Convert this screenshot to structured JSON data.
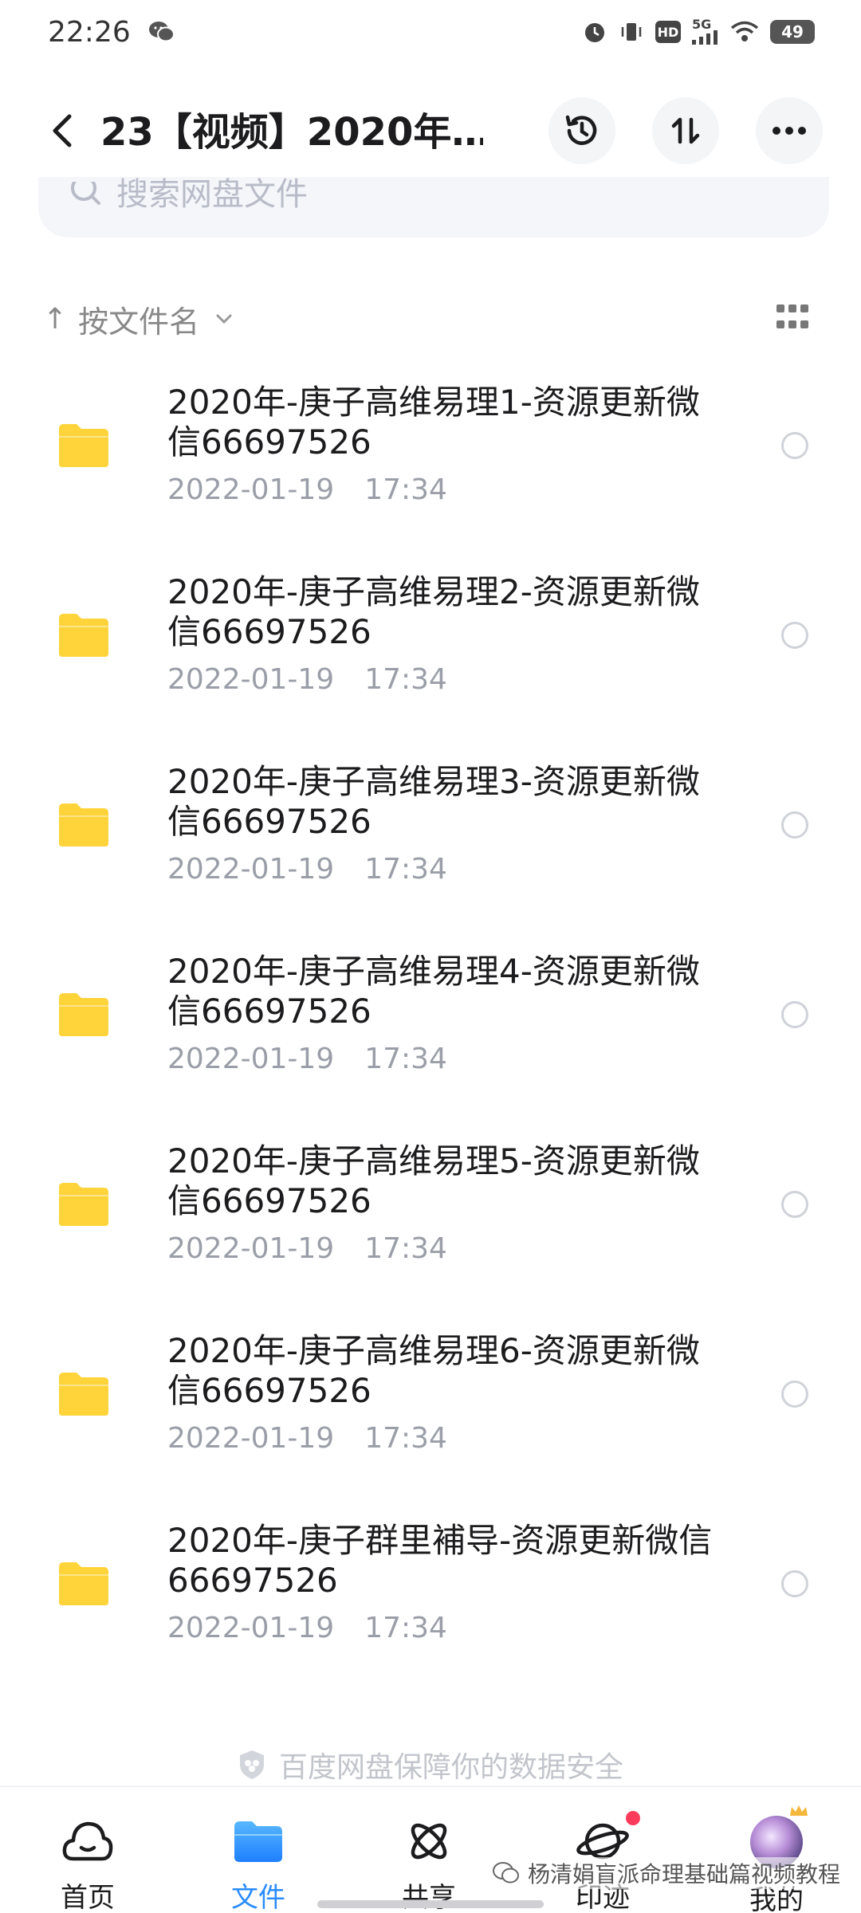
{
  "status_bar": {
    "time": "22:26",
    "battery": "49",
    "network": "5G",
    "hd": "HD"
  },
  "header": {
    "title": "23【视频】2020年…"
  },
  "search": {
    "placeholder": "搜索网盘文件"
  },
  "sort": {
    "label": "按文件名",
    "arrow": "↑"
  },
  "files": [
    {
      "name": "2020年-庚子高维易理1-资源更新微信66697526",
      "date": "2022-01-19",
      "time": "17:34"
    },
    {
      "name": "2020年-庚子高维易理2-资源更新微信66697526",
      "date": "2022-01-19",
      "time": "17:34"
    },
    {
      "name": "2020年-庚子高维易理3-资源更新微信66697526",
      "date": "2022-01-19",
      "time": "17:34"
    },
    {
      "name": "2020年-庚子高维易理4-资源更新微信66697526",
      "date": "2022-01-19",
      "time": "17:34"
    },
    {
      "name": "2020年-庚子高维易理5-资源更新微信66697526",
      "date": "2022-01-19",
      "time": "17:34"
    },
    {
      "name": "2020年-庚子高维易理6-资源更新微信66697526",
      "date": "2022-01-19",
      "time": "17:34"
    },
    {
      "name": "2020年-庚子群里補导-资源更新微信66697526",
      "date": "2022-01-19",
      "time": "17:34"
    }
  ],
  "security_notice": "百度网盘保障你的数据安全",
  "nav": {
    "home": "首页",
    "files": "文件",
    "share": "共享",
    "footprint": "印迹",
    "mine": "我的"
  },
  "watermark": "杨清娟盲派命理基础篇视频教程",
  "colors": {
    "accent": "#2a8cff",
    "folder": "#ffd43b",
    "badge": "#ff3b5c"
  }
}
